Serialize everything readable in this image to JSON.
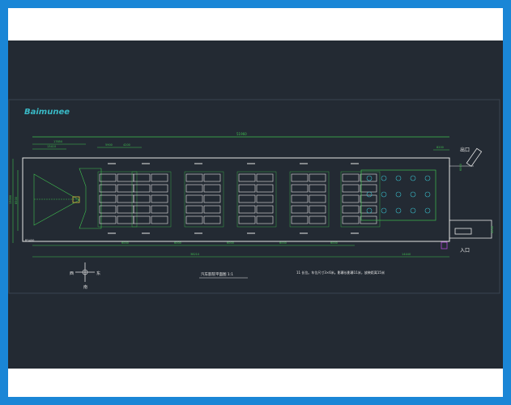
{
  "logo_text": "Baimunee",
  "dimensions": {
    "total_length": "51960",
    "top_left_1": "17850",
    "top_left_2": "13410",
    "top_mid_1": "5900",
    "top_mid_2": "4200",
    "top_right": "8200",
    "right_vertical": "6000",
    "left_vertical_1": "13000",
    "left_vertical_2": "8500",
    "bottom_seg_1": "6000",
    "bottom_seg_2": "6000",
    "bottom_seg_3": "6000",
    "bottom_seg_4": "6000",
    "bottom_seg_5": "6000",
    "bottom_total_left": "38210",
    "bottom_total_right": "14440",
    "entrance_lane": "4000",
    "small_note": "R5400"
  },
  "labels": {
    "exit": "出口",
    "entrance": "入口",
    "compass_west": "西",
    "compass_east": "东",
    "compass_south": "南",
    "drawing_title": "汽车影院平面图 1:1",
    "note": "11 长位。车位尺寸3×6米。影幕长影幕11米，放映距离15米"
  },
  "colors": {
    "background": "#232a33",
    "frame": "#1a86d6",
    "line_green": "#3fbf4f",
    "line_white": "#e6e6e6",
    "line_yellow": "#d8c23a",
    "accent_cyan": "#39b9c6"
  }
}
